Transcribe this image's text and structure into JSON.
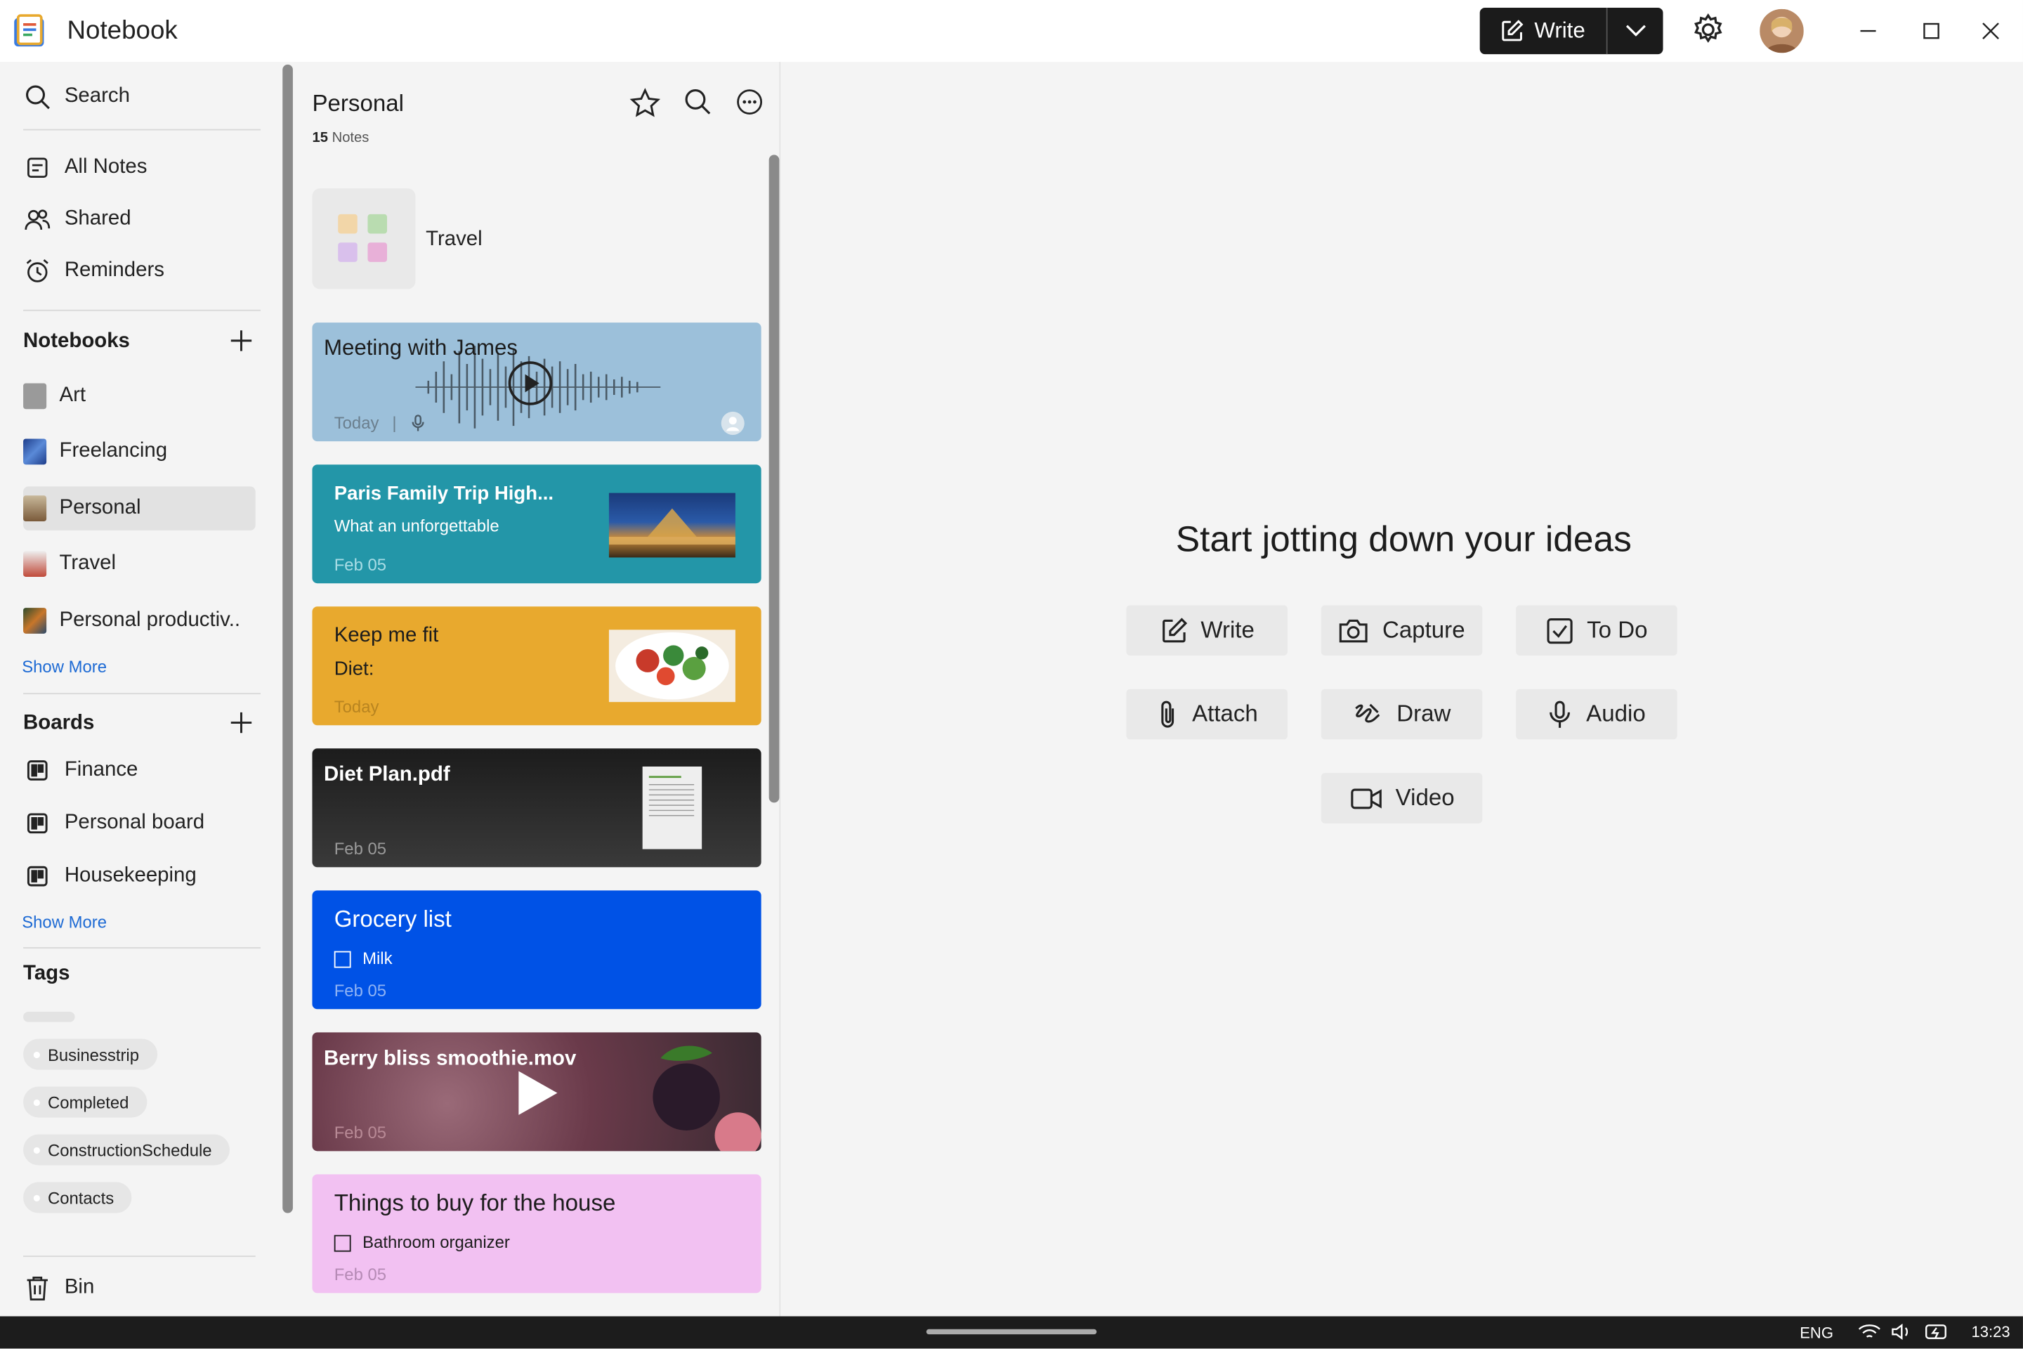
{
  "app": {
    "title": "Notebook"
  },
  "titlebar": {
    "write_label": "Write"
  },
  "sidebar": {
    "search_label": "Search",
    "nav": [
      {
        "label": "All Notes",
        "icon": "note-icon"
      },
      {
        "label": "Shared",
        "icon": "people-icon"
      },
      {
        "label": "Reminders",
        "icon": "alarm-icon"
      }
    ],
    "notebooks_header": "Notebooks",
    "notebooks": [
      {
        "label": "Art",
        "color": "#8a8a8a"
      },
      {
        "label": "Freelancing",
        "color": "#2d56a8"
      },
      {
        "label": "Personal",
        "color": "#8a6d4b",
        "selected": true
      },
      {
        "label": "Travel",
        "color": "#b44a3a"
      },
      {
        "label": "Personal productiv..",
        "color": "#3b5a3a"
      }
    ],
    "show_more_notebooks": "Show More",
    "boards_header": "Boards",
    "boards": [
      {
        "label": "Finance"
      },
      {
        "label": "Personal board"
      },
      {
        "label": "Housekeeping"
      }
    ],
    "show_more_boards": "Show More",
    "tags_header": "Tags",
    "tags": [
      {
        "label": "Businesstrip"
      },
      {
        "label": "Completed"
      },
      {
        "label": "ConstructionSchedule"
      },
      {
        "label": "Contacts"
      }
    ],
    "bin_label": "Bin"
  },
  "notelist": {
    "title": "Personal",
    "count": "15",
    "count_label": "Notes",
    "group_label": "Travel",
    "cards": [
      {
        "title": "Meeting with James",
        "date": "Today",
        "bg": "#9cc0da"
      },
      {
        "title": "Paris Family Trip High...",
        "body": "What an unforgettable",
        "date": "Feb 05",
        "bg": "#2396a8"
      },
      {
        "title": "Keep me fit",
        "body": "Diet:",
        "date": "Today",
        "bg": "#e8a92e"
      },
      {
        "title": "Diet Plan.pdf",
        "date": "Feb 05",
        "bg": "#2b2b2b"
      },
      {
        "title": "Grocery list",
        "item": "Milk",
        "date": "Feb 05",
        "bg": "#0052e6"
      },
      {
        "title": "Berry bliss smoothie.mov",
        "date": "Feb 05",
        "bg": "#7a4a58"
      },
      {
        "title": "Things to buy for the house",
        "item": "Bathroom organizer",
        "date": "Feb 05",
        "bg": "#f2c1f2"
      }
    ]
  },
  "main": {
    "empty_title": "Start jotting down your ideas",
    "actions": [
      {
        "label": "Write",
        "icon": "pencil-icon"
      },
      {
        "label": "Capture",
        "icon": "camera-icon"
      },
      {
        "label": "To Do",
        "icon": "checkbox-icon"
      },
      {
        "label": "Attach",
        "icon": "paperclip-icon"
      },
      {
        "label": "Draw",
        "icon": "scribble-icon"
      },
      {
        "label": "Audio",
        "icon": "microphone-icon"
      },
      {
        "label": "Video",
        "icon": "video-camera-icon"
      }
    ]
  },
  "taskbar": {
    "language": "ENG",
    "time": "13:23"
  }
}
